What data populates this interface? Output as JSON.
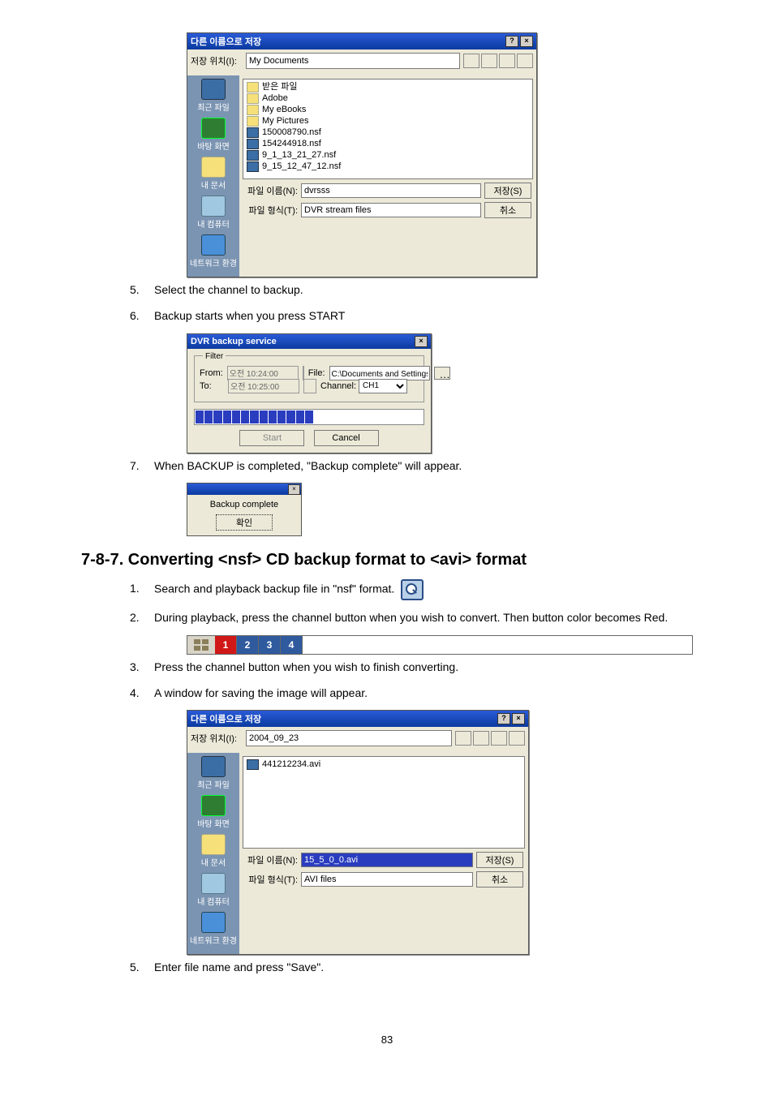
{
  "dialog1": {
    "title": "다른 이름으로 저장",
    "look_in_label": "저장 위치(I):",
    "look_in_value": "My Documents",
    "places": [
      "최근 파일",
      "바탕 화면",
      "내 문서",
      "내 컴퓨터",
      "네트워크 환경"
    ],
    "files": [
      {
        "name": "받은 파일",
        "type": "folder"
      },
      {
        "name": "Adobe",
        "type": "folder"
      },
      {
        "name": "My eBooks",
        "type": "folder"
      },
      {
        "name": "My Pictures",
        "type": "folder"
      },
      {
        "name": "150008790.nsf",
        "type": "nsf"
      },
      {
        "name": "154244918.nsf",
        "type": "nsf"
      },
      {
        "name": "9_1_13_21_27.nsf",
        "type": "nsf"
      },
      {
        "name": "9_15_12_47_12.nsf",
        "type": "nsf"
      }
    ],
    "fname_label": "파일 이름(N):",
    "fname_value": "dvrsss",
    "ftype_label": "파일 형식(T):",
    "ftype_value": "DVR stream files",
    "save_btn": "저장(S)",
    "cancel_btn": "취소"
  },
  "steps_a": {
    "s5": "Select the channel to backup.",
    "s6": "Backup starts when you press START"
  },
  "dialog2": {
    "title": "DVR backup service",
    "filter_legend": "Filter",
    "from_label": "From:",
    "from_value": "오전 10:24:00",
    "to_label": "To:",
    "to_value": "오전 10:25:00",
    "file_label": "File:",
    "file_value": "C:\\Documents and Settings\\일",
    "channel_label": "Channel:",
    "channel_value": "CH1",
    "start_btn": "Start",
    "cancel_btn": "Cancel"
  },
  "steps_b": {
    "s7": "When BACKUP is completed, \"Backup complete\" will appear."
  },
  "alert": {
    "msg": "Backup complete",
    "ok": "확인"
  },
  "heading": "7-8-7. Converting <nsf> CD backup format to <avi> format",
  "steps_c": {
    "s1": "Search and playback backup file in \"nsf\" format.",
    "s2": "During playback, press the channel button when you wish to convert. Then button color becomes Red.",
    "s3": "Press the channel button when you wish to finish converting.",
    "s4": "A window for saving the image will appear."
  },
  "channel_labels": [
    "1",
    "2",
    "3",
    "4"
  ],
  "dialog3": {
    "title": "다른 이름으로 저장",
    "look_in_label": "저장 위치(I):",
    "look_in_value": "2004_09_23",
    "places": [
      "최근 파일",
      "바탕 화면",
      "내 문서",
      "내 컴퓨터",
      "네트워크 환경"
    ],
    "files": [
      {
        "name": "441212234.avi",
        "type": "nsf"
      }
    ],
    "fname_label": "파일 이름(N):",
    "fname_value": "15_5_0_0.avi",
    "ftype_label": "파일 형식(T):",
    "ftype_value": "AVI files",
    "save_btn": "저장(S)",
    "cancel_btn": "취소"
  },
  "steps_d": {
    "s5": "Enter file name and press \"Save\"."
  },
  "page_number": "83"
}
